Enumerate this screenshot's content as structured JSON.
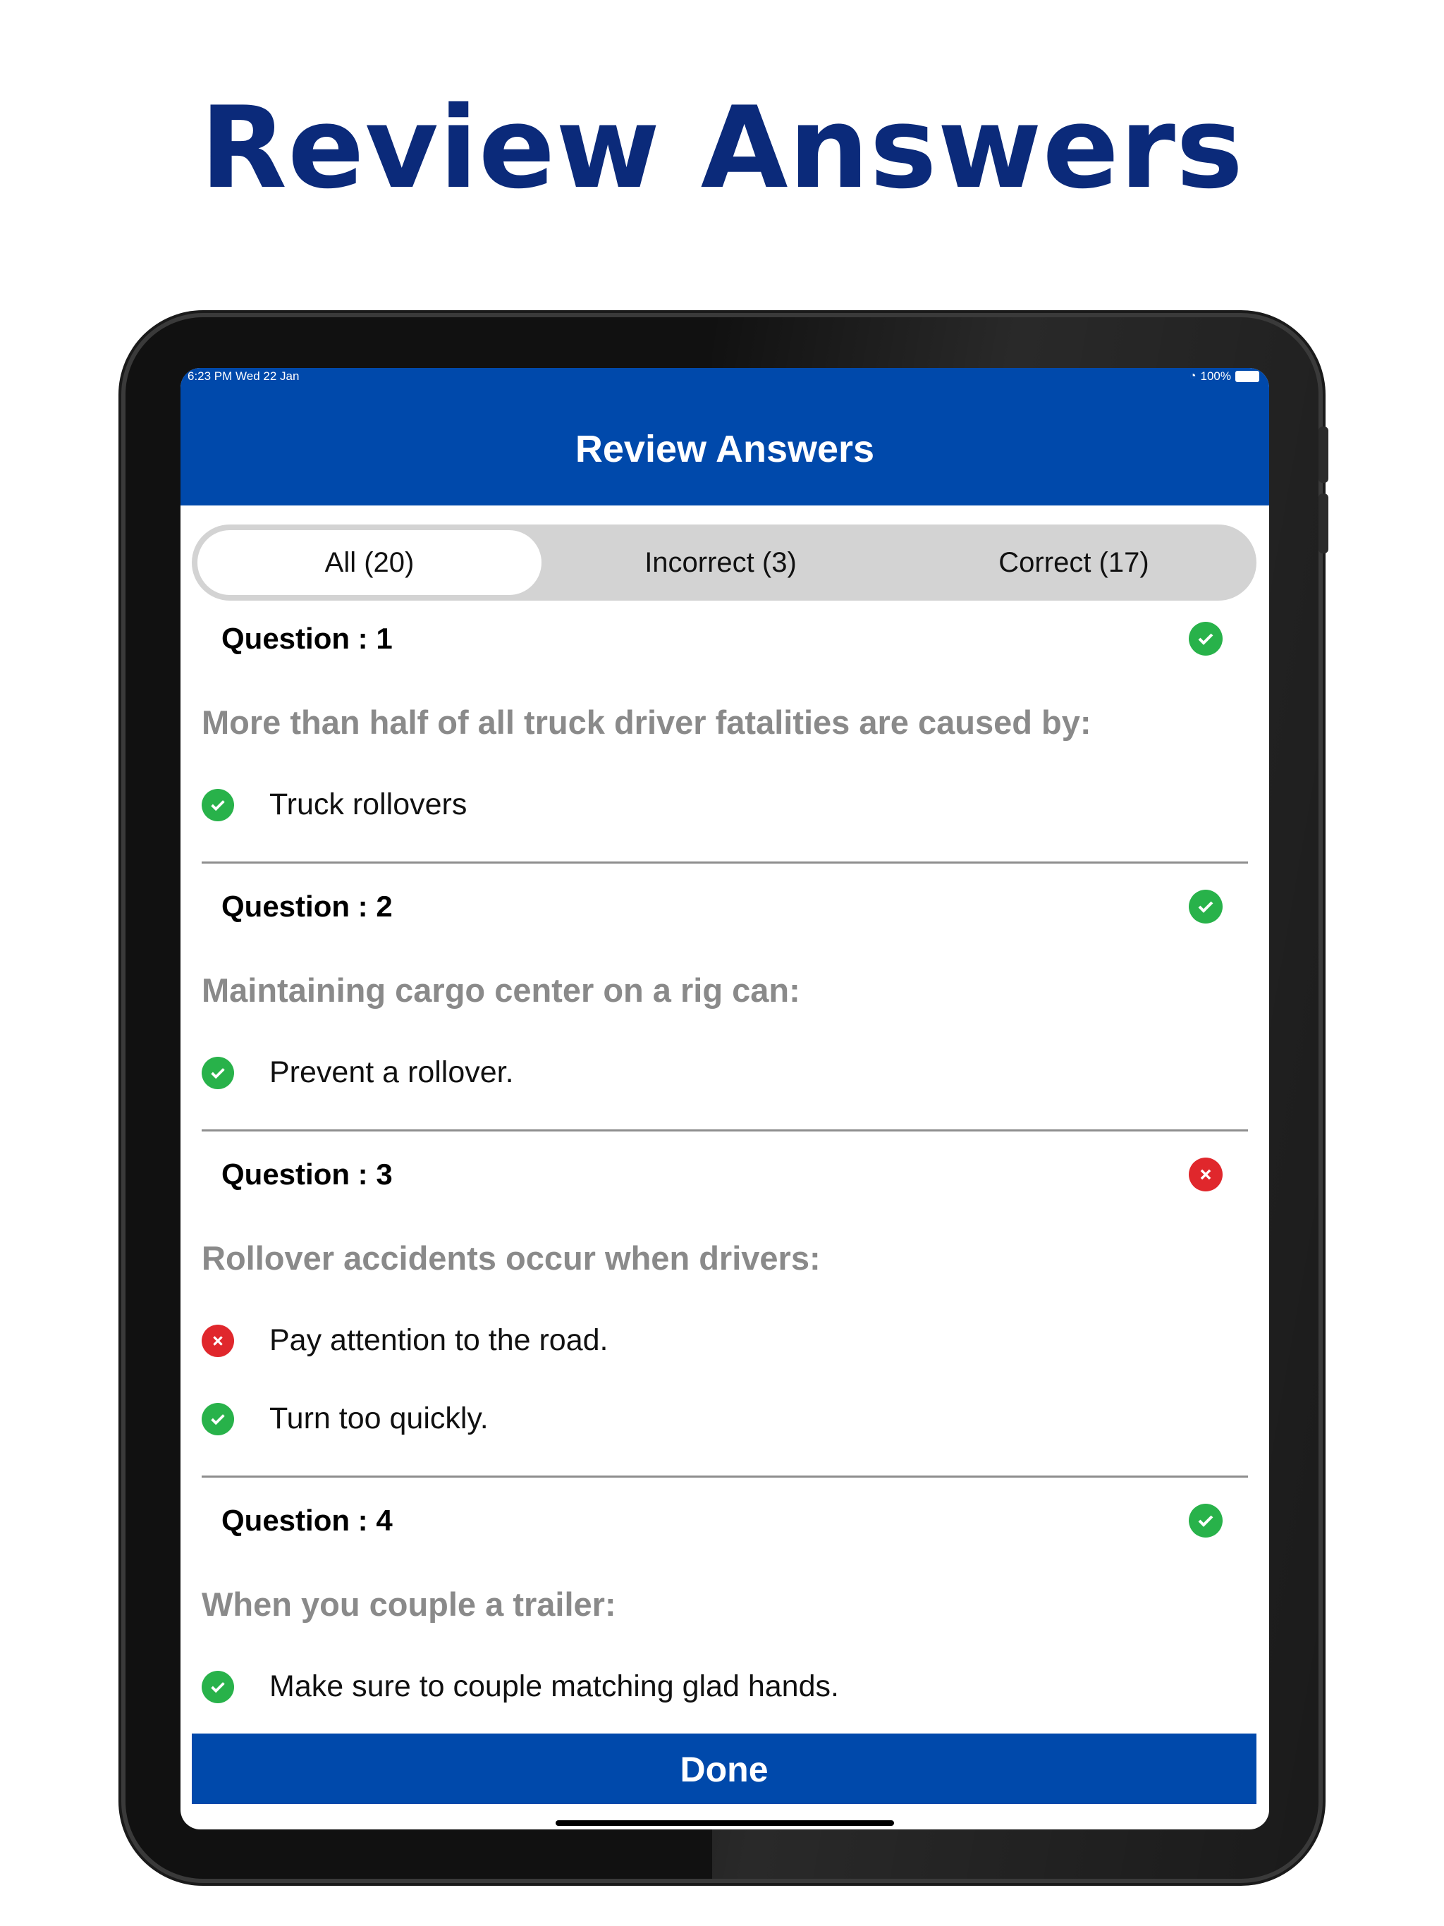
{
  "hero_title": "Review Answers",
  "status_bar": {
    "left": "6:23 PM   Wed 22 Jan",
    "battery": "100%"
  },
  "header": {
    "title": "Review Answers"
  },
  "filter_tabs": [
    {
      "label": "All (20)"
    },
    {
      "label": "Incorrect (3)"
    },
    {
      "label": "Correct (17)"
    }
  ],
  "questions": [
    {
      "heading": "Question : 1",
      "status": "correct",
      "text": "More than half of all truck driver fatalities are caused by:",
      "answers": [
        {
          "text": "Truck rollovers",
          "status": "correct"
        }
      ]
    },
    {
      "heading": "Question : 2",
      "status": "correct",
      "text": "Maintaining cargo center on a rig can:",
      "answers": [
        {
          "text": "Prevent a rollover.",
          "status": "correct"
        }
      ]
    },
    {
      "heading": "Question : 3",
      "status": "incorrect",
      "text": "Rollover accidents occur when drivers:",
      "answers": [
        {
          "text": "Pay attention to the road.",
          "status": "incorrect"
        },
        {
          "text": "Turn too quickly.",
          "status": "correct"
        }
      ]
    },
    {
      "heading": "Question : 4",
      "status": "correct",
      "text": "When you couple a trailer:",
      "answers": [
        {
          "text": "Make sure to couple matching glad hands.",
          "status": "correct"
        }
      ]
    }
  ],
  "done_button": "Done",
  "colors": {
    "brand": "#0049ab",
    "title": "#0b2a7a",
    "correct": "#28b24a",
    "incorrect": "#e0272c"
  },
  "icons": {
    "correct": "check-circle-icon",
    "incorrect": "x-circle-icon"
  }
}
